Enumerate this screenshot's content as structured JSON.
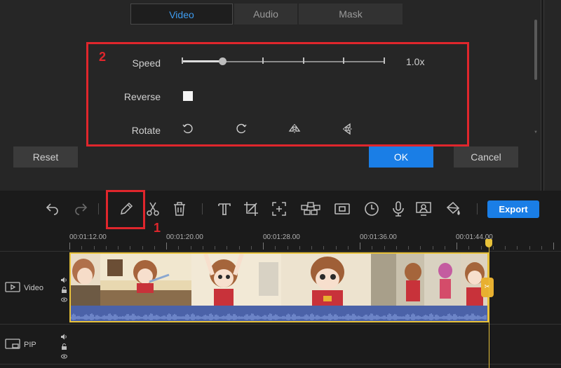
{
  "tabs": [
    {
      "label": "Video",
      "active": true
    },
    {
      "label": "Audio",
      "active": false
    },
    {
      "label": "Mask",
      "active": false
    }
  ],
  "properties": {
    "speed_label": "Speed",
    "speed_value": "1.0x",
    "speed_fraction": 0.2,
    "reverse_label": "Reverse",
    "reverse_checked": false,
    "rotate_label": "Rotate",
    "rotate_buttons": [
      "rotate-left-icon",
      "rotate-right-icon",
      "flip-horizontal-icon",
      "flip-vertical-icon"
    ]
  },
  "annotations": {
    "edit_number": "1",
    "panel_number": "2",
    "color": "#e0262c"
  },
  "buttons": {
    "reset": "Reset",
    "ok": "OK",
    "cancel": "Cancel",
    "export": "Export"
  },
  "toolbar_icons": [
    "undo-icon",
    "redo-icon",
    "edit-pencil-icon",
    "cut-icon",
    "delete-icon",
    "text-icon",
    "crop-icon",
    "zoom-icon",
    "mosaic-icon",
    "freeze-frame-icon",
    "duration-icon",
    "voiceover-icon",
    "webcam-icon",
    "fill-icon"
  ],
  "ruler": {
    "labels": [
      "00:01:12.00",
      "00:01:20.00",
      "00:01:28.00",
      "00:01:36.00",
      "00:01:44.00"
    ]
  },
  "tracks": {
    "video_label": "Video",
    "pip_label": "PIP"
  },
  "colors": {
    "accent": "#1a7ee6",
    "clip_border": "#e8c23a",
    "waveform": "#4b62a8"
  }
}
